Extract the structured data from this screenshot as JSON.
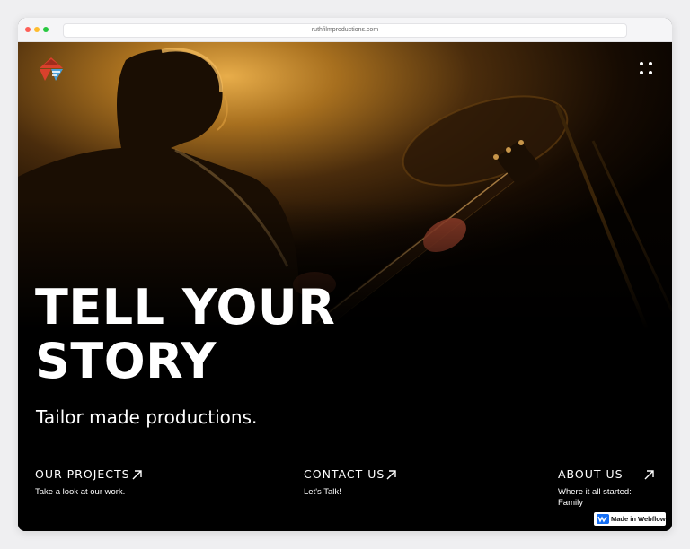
{
  "browser": {
    "url": "ruthfilmproductions.com"
  },
  "hero": {
    "headline_line1": "TELL YOUR",
    "headline_line2": "STORY",
    "tagline": "Tailor made productions."
  },
  "nav_links": [
    {
      "title": "OUR PROJECTS",
      "subtitle": "Take a look at our work."
    },
    {
      "title": "CONTACT US",
      "subtitle": "Let's Talk!"
    },
    {
      "title": "ABOUT US",
      "subtitle": "Where it all started: Family"
    }
  ],
  "badge": {
    "label": "Made in Webflow"
  },
  "icons": {
    "logo": "company-logo",
    "menu": "menu-dots-icon",
    "arrow": "arrow-up-right-icon",
    "badge": "webflow-logo-icon"
  },
  "colors": {
    "background": "#000000",
    "text": "#ffffff",
    "stage_light": "#d89a3a",
    "logo_red": "#d9412c",
    "logo_blue": "#4a9fd5",
    "webflow_blue": "#146ef5"
  }
}
